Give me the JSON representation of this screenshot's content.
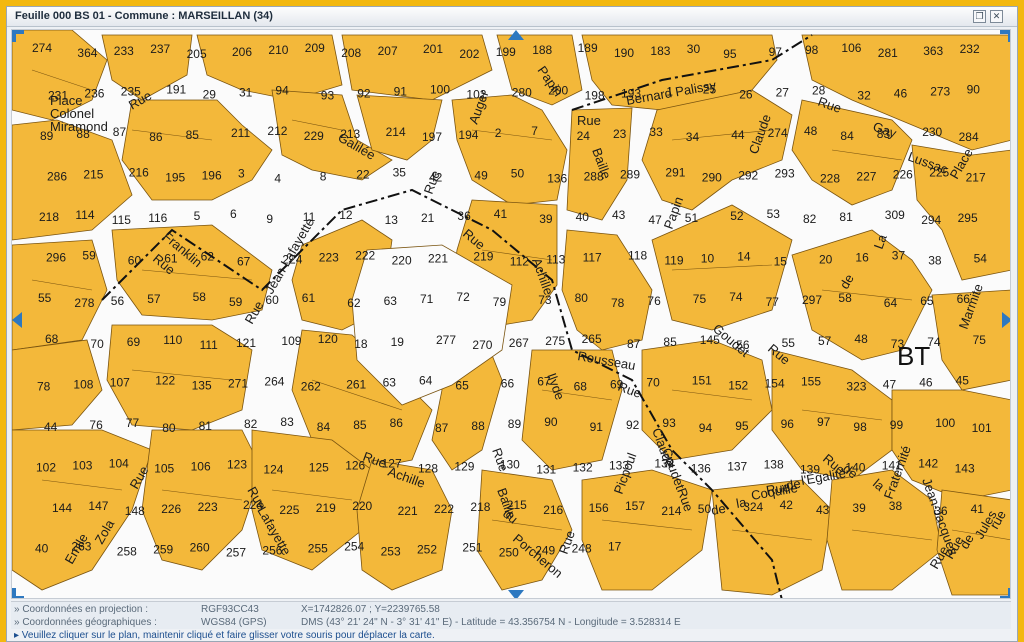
{
  "window": {
    "title": "Feuille 000 BS 01 - Commune : MARSEILLAN (34)",
    "restore_icon": "restore-window-icon",
    "close_icon": "close-window-icon"
  },
  "map": {
    "section": "BT",
    "colors": {
      "parcel": "#f3b83a",
      "parcel_stroke": "#7a5410",
      "street": "#fbfbfb",
      "accent": "#2d78c0"
    },
    "place": [
      "Place",
      "Colonel",
      "Miramond"
    ],
    "streets": [
      "Rue",
      "Galilée",
      "Rue",
      "Auger",
      "Papin",
      "Rue",
      "Bernard Palissy",
      "Rue",
      "Gay",
      "Lussac",
      "Place",
      "Rue",
      "Franklin",
      "Rue",
      "Jean Lafayette",
      "Rue",
      "Achille",
      "Baille",
      "Papin",
      "Claude",
      "Goudet",
      "Rue",
      "de",
      "La",
      "Marmite",
      "Rousseau",
      "Rue",
      "Ilyde",
      "Rue",
      "Baille",
      "Rue",
      "Achille",
      "Rue",
      "Lafayette",
      "Rue",
      "Emile",
      "Zola",
      "Rue",
      "du",
      "Porcheron",
      "Rue",
      "Picpoul",
      "Claude",
      "Goudet",
      "Rue",
      "de",
      "la",
      "Coquille",
      "Rue",
      "de",
      "l'Egalité",
      "Rue",
      "de",
      "la",
      "Fraternité",
      "Jean-Jacques",
      "Rue",
      "Rue",
      "de",
      "Jules",
      "rue"
    ],
    "parcels": [
      "274",
      "364",
      "233",
      "237",
      "205",
      "206",
      "210",
      "209",
      "208",
      "207",
      "201",
      "202",
      "199",
      "188",
      "189",
      "190",
      "183",
      "30",
      "95",
      "97",
      "98",
      "106",
      "281",
      "363",
      "232",
      "231",
      "236",
      "235",
      "191",
      "29",
      "31",
      "94",
      "93",
      "92",
      "91",
      "100",
      "102",
      "280",
      "200",
      "198",
      "193",
      "1",
      "25",
      "26",
      "27",
      "28",
      "32",
      "46",
      "273",
      "90",
      "89",
      "88",
      "87",
      "86",
      "85",
      "211",
      "212",
      "229",
      "213",
      "214",
      "197",
      "194",
      "2",
      "7",
      "24",
      "23",
      "33",
      "34",
      "44",
      "274",
      "48",
      "84",
      "83",
      "230",
      "284",
      "286",
      "215",
      "216",
      "195",
      "196",
      "3",
      "4",
      "8",
      "22",
      "35",
      "42",
      "49",
      "50",
      "136",
      "288",
      "289",
      "291",
      "290",
      "292",
      "293",
      "228",
      "227",
      "226",
      "225",
      "217",
      "218",
      "114",
      "115",
      "116",
      "5",
      "6",
      "9",
      "11",
      "12",
      "13",
      "21",
      "36",
      "41",
      "39",
      "40",
      "43",
      "47",
      "51",
      "52",
      "53",
      "82",
      "81",
      "309",
      "294",
      "295",
      "296",
      "59",
      "60",
      "61",
      "62",
      "67",
      "224",
      "223",
      "222",
      "220",
      "221",
      "219",
      "112",
      "113",
      "117",
      "118",
      "119",
      "10",
      "14",
      "15",
      "20",
      "16",
      "37",
      "38",
      "54",
      "55",
      "278",
      "56",
      "57",
      "58",
      "59",
      "60",
      "61",
      "62",
      "63",
      "71",
      "72",
      "79",
      "73",
      "80",
      "78",
      "76",
      "75",
      "74",
      "77",
      "297",
      "58",
      "64",
      "65",
      "66",
      "68",
      "70",
      "69",
      "110",
      "111",
      "121",
      "109",
      "120",
      "18",
      "19",
      "277",
      "270",
      "267",
      "275",
      "265",
      "87",
      "85",
      "145",
      "56",
      "55",
      "57",
      "48",
      "73",
      "74",
      "75",
      "78",
      "108",
      "107",
      "122",
      "135",
      "271",
      "264",
      "262",
      "261",
      "63",
      "64",
      "65",
      "66",
      "67",
      "68",
      "69",
      "70",
      "151",
      "152",
      "154",
      "155",
      "323",
      "47",
      "46",
      "45",
      "44",
      "76",
      "77",
      "80",
      "81",
      "82",
      "83",
      "84",
      "85",
      "86",
      "87",
      "88",
      "89",
      "90",
      "91",
      "92",
      "93",
      "94",
      "95",
      "96",
      "97",
      "98",
      "99",
      "100",
      "101",
      "102",
      "103",
      "104",
      "105",
      "106",
      "123",
      "124",
      "125",
      "126",
      "127",
      "128",
      "129",
      "130",
      "131",
      "132",
      "133",
      "134",
      "136",
      "137",
      "138",
      "139",
      "140",
      "141",
      "142",
      "143",
      "144",
      "147",
      "148",
      "226",
      "223",
      "224",
      "225",
      "219",
      "220",
      "221",
      "222",
      "218",
      "215",
      "216",
      "156",
      "157",
      "214",
      "50",
      "324",
      "42",
      "43",
      "39",
      "38",
      "36",
      "41",
      "40",
      "263",
      "258",
      "259",
      "260",
      "257",
      "256",
      "255",
      "254",
      "253",
      "252",
      "251",
      "250",
      "249",
      "248",
      "17"
    ],
    "pan_controls": [
      "pan-up",
      "pan-down",
      "pan-left",
      "pan-right"
    ]
  },
  "coords": {
    "projection_label": "» Coordonnées en projection :",
    "projection_system": "RGF93CC43",
    "projection_value": "X=1742826.07 ; Y=2239765.58",
    "geo_label": "» Coordonnées géographiques :",
    "geo_system": "WGS84 (GPS)",
    "geo_value": "DMS (43° 21' 24\" N - 3° 31' 41\" E) - Latitude = 43.356754 N - Longitude = 3.528314 E"
  },
  "status": "▸ Veuillez cliquer sur le plan, maintenir cliqué et faire glisser votre souris pour déplacer la carte."
}
